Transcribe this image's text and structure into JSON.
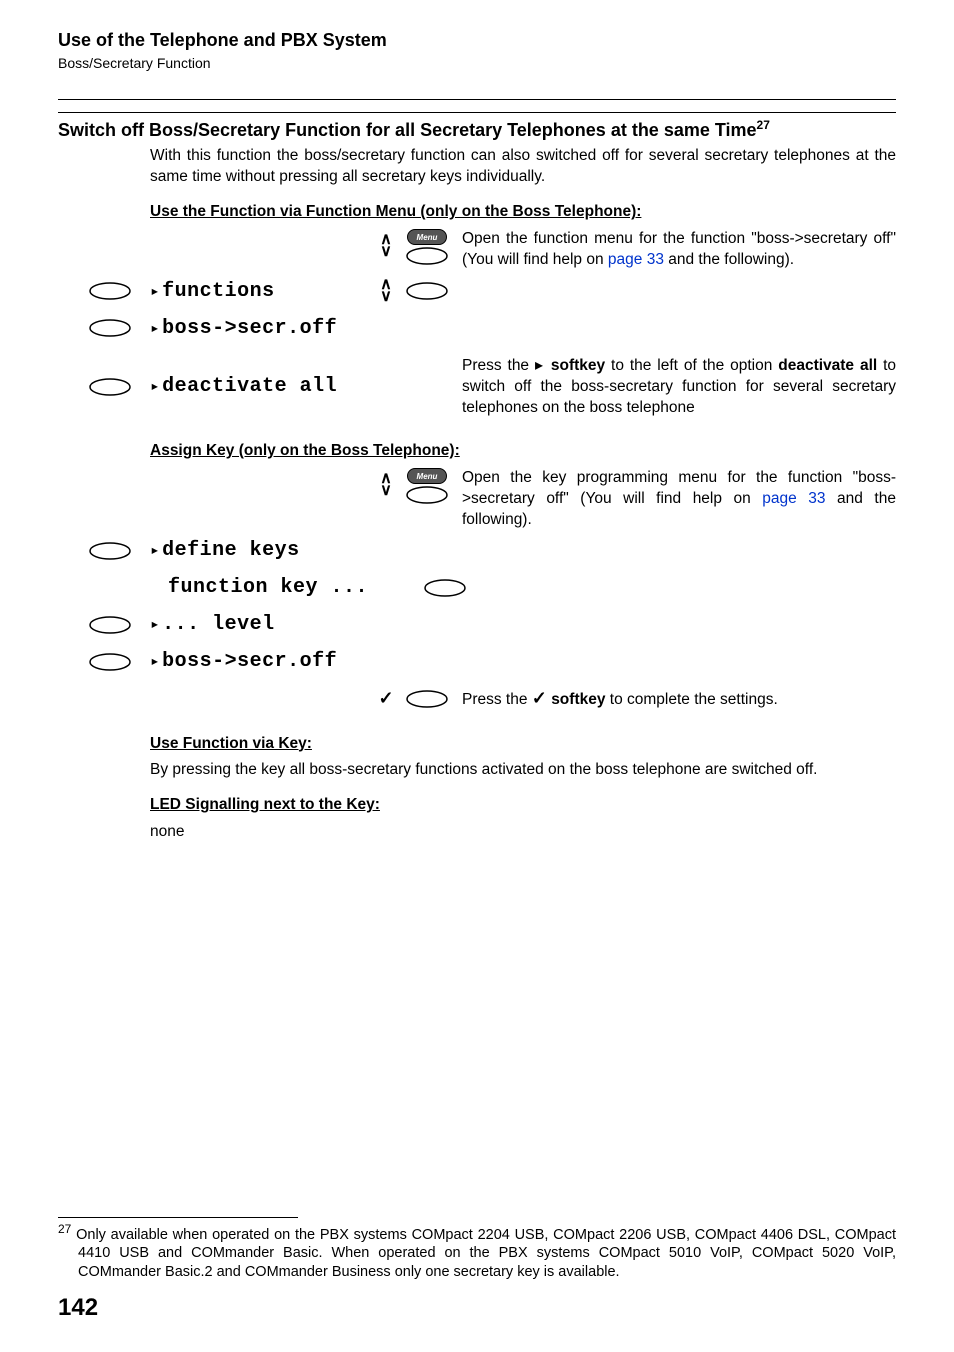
{
  "header": {
    "title": "Use of the Telephone and PBX System",
    "subtitle": "Boss/Secretary Function"
  },
  "section": {
    "heading_pre": "Switch off Boss/Secretary Function for all Secretary Telephones at the same Time",
    "fn_ref": "27",
    "intro": "With this function the boss/secretary function can also switched off for several secretary telephones at the same time without pressing all secretary keys individually."
  },
  "sub1": {
    "heading": "Use the Function via Function Menu (only on the Boss Telephone):",
    "desc_open_pre": "Open the function menu for the function \"boss->secretary off\" (You will find help on ",
    "desc_open_link": "page 33",
    "desc_open_post": " and the following).",
    "lcd_functions": "functions",
    "lcd_boss_off": "boss->secr.off",
    "lcd_deactivate": "deactivate all",
    "desc_press_pre": "Press the ",
    "desc_press_key": "softkey",
    "desc_press_mid": " to the left of the option ",
    "desc_press_bold": "deactivate all",
    "desc_press_post": " to switch off the boss-secretary function for several secretary telephones on the boss telephone"
  },
  "sub2": {
    "heading": "Assign Key (only on the Boss Telephone):",
    "desc_open_pre": "Open the key programming menu for the function \"boss->secretary off\" (You will find help on ",
    "desc_open_link": "page 33",
    "desc_open_post": " and the following).",
    "lcd_define": "define keys",
    "lcd_funckey": "function key ...",
    "lcd_level": "... level",
    "lcd_boss_off": "boss->secr.off",
    "desc_press_pre": "Press the ",
    "desc_press_key": "softkey",
    "desc_press_post": " to complete the settings."
  },
  "sub3": {
    "heading": "Use Function via Key:",
    "body": "By pressing the key all boss-secretary functions activated on the boss telephone are switched off."
  },
  "sub4": {
    "heading": "LED Signalling next to the Key:",
    "body": "none"
  },
  "footnote": {
    "num": "27",
    "text": " Only available when operated on the PBX systems COMpact 2204 USB, COMpact 2206 USB, COMpact 4406 DSL, COMpact 4410 USB and COMmander Basic. When operated on the PBX systems COMpact 5010 VoIP, COMpact 5020 VoIP, COMmander Basic.2 and COMmander Business only one secretary key is available."
  },
  "pagenum": "142"
}
